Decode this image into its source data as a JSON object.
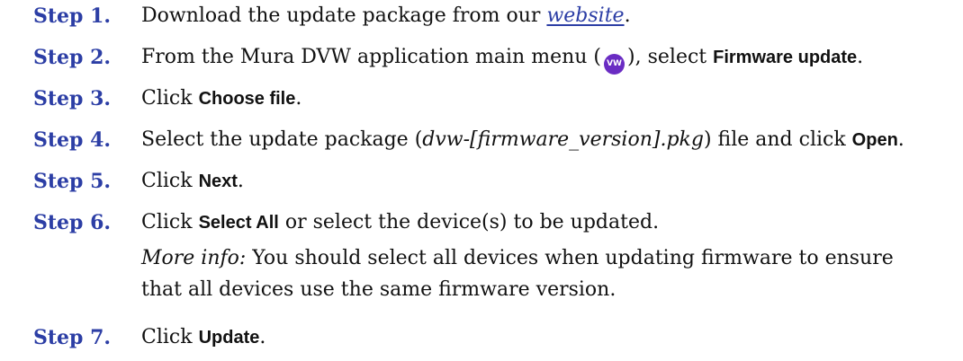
{
  "steps": [
    {
      "label": "Step 1.",
      "parts": {
        "a": "Download the update package from our ",
        "link": "website",
        "b": "."
      }
    },
    {
      "label": "Step 2.",
      "parts": {
        "a": "From the Mura DVW application main menu (",
        "icon_text": "VW",
        "b": "), select ",
        "ui": "Firmware update",
        "c": "."
      }
    },
    {
      "label": "Step 3.",
      "parts": {
        "a": "Click ",
        "ui": "Choose file",
        "b": "."
      }
    },
    {
      "label": "Step 4.",
      "parts": {
        "a": "Select the update package (",
        "ital": "dvw-[firmware_version].pkg",
        "b": ") file and click ",
        "ui": "Open",
        "c": "."
      }
    },
    {
      "label": "Step 5.",
      "parts": {
        "a": "Click ",
        "ui": "Next",
        "b": "."
      }
    },
    {
      "label": "Step 6.",
      "parts": {
        "a": "Click ",
        "ui": "Select All",
        "b": " or select the device(s) to be updated."
      },
      "more_info": {
        "label": "More info:",
        "text": " You should select all devices when updating firmware to ensure that all devices use the same firmware version."
      }
    },
    {
      "label": "Step 7.",
      "parts": {
        "a": "Click ",
        "ui": "Update",
        "b": "."
      }
    }
  ],
  "colors": {
    "step_label": "#2c3ea5",
    "link": "#2c3ea5",
    "menu_icon": "#6a2cc3"
  },
  "icons": {
    "main_menu": "main-menu-icon"
  }
}
